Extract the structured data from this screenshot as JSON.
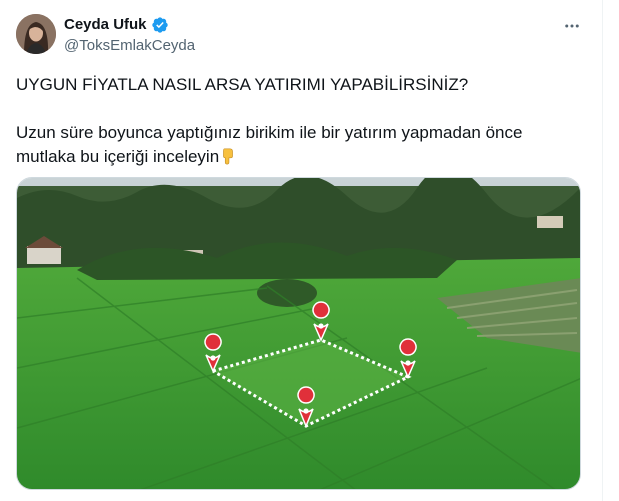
{
  "tweet": {
    "author": {
      "display_name": "Ceyda Ufuk",
      "handle": "@ToksEmlakCeyda",
      "verified_icon": "verified-badge-icon",
      "avatar_icon": "avatar-photo"
    },
    "more_icon": "more-options-icon",
    "text": {
      "headline": "UYGUN FİYATLA NASIL ARSA YATIRIMI YAPABİLİRSİNİZ?",
      "body_line1": "Uzun süre boyunca yaptığınız birikim ile bir yatırım yapmadan önce",
      "body_line2": "mutlaka bu içeriği inceleyin",
      "emoji": "backhand-index-pointing-down"
    },
    "media": {
      "image": "aerial-green-field-with-plot-markers",
      "colors": {
        "field": "#3f9a35",
        "trees": "#2f5a28",
        "pin": "#e0303a"
      }
    }
  }
}
